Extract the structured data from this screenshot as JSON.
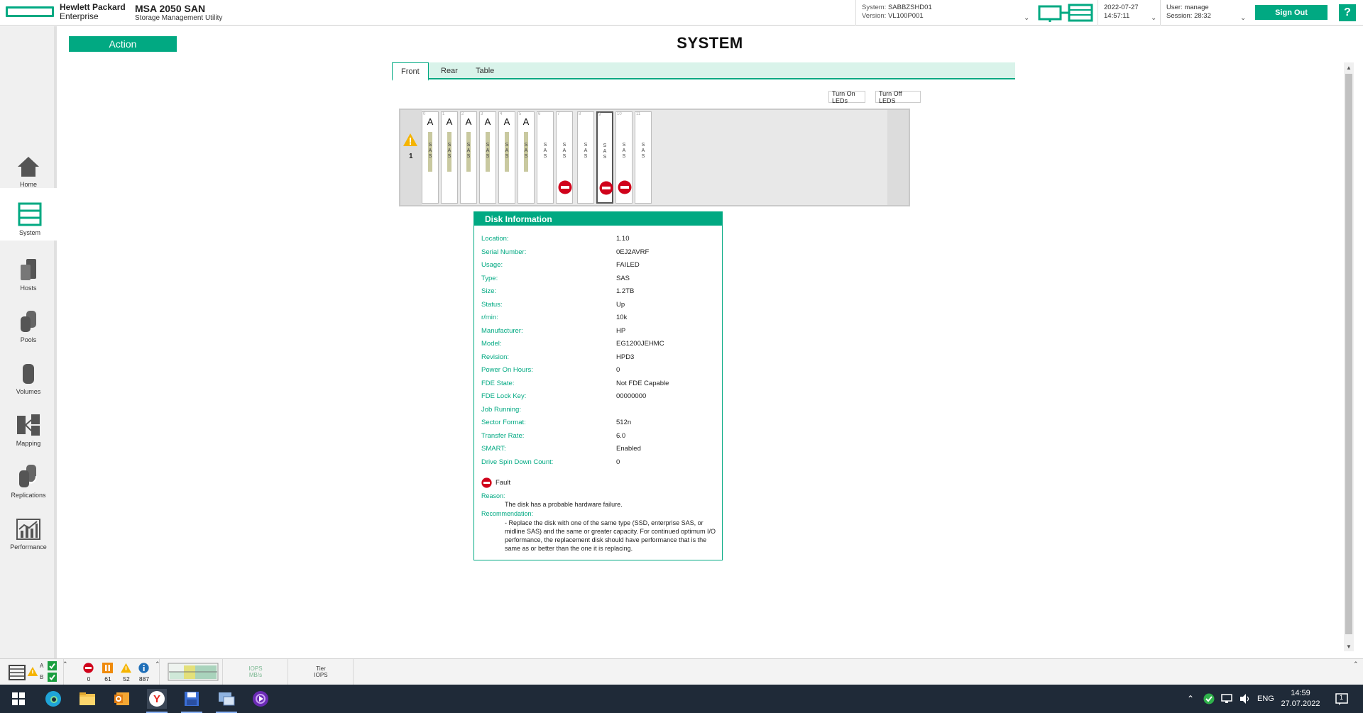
{
  "header": {
    "brand_line1": "Hewlett Packard",
    "brand_line2": "Enterprise",
    "product_name": "MSA 2050 SAN",
    "product_sub": "Storage Management Utility",
    "system_label": "System:",
    "system_value": "SABBZSHD01",
    "version_label": "Version:",
    "version_value": "VL100P001",
    "date": "2022-07-27",
    "time": "14:57:11",
    "user_label": "User:",
    "user_value": "manage",
    "session_label": "Session:",
    "session_value": "28:32",
    "sign_out": "Sign Out",
    "help": "?",
    "accent": "#01a982"
  },
  "nav": {
    "items": [
      {
        "label": "Home",
        "icon": "home-icon"
      },
      {
        "label": "System",
        "icon": "system-icon",
        "active": true
      },
      {
        "label": "Hosts",
        "icon": "hosts-icon"
      },
      {
        "label": "Pools",
        "icon": "pools-icon"
      },
      {
        "label": "Volumes",
        "icon": "volumes-icon"
      },
      {
        "label": "Mapping",
        "icon": "mapping-icon"
      },
      {
        "label": "Replications",
        "icon": "replications-icon"
      },
      {
        "label": "Performance",
        "icon": "performance-icon"
      }
    ]
  },
  "main": {
    "action_label": "Action",
    "title": "SYSTEM",
    "tabs": [
      {
        "label": "Front",
        "active": true
      },
      {
        "label": "Rear"
      },
      {
        "label": "Table"
      }
    ],
    "turn_on_leds": "Turn On LEDs",
    "turn_off_leds": "Turn Off LEDS",
    "enclosure_number": "1",
    "slots": [
      {
        "pool": "A",
        "type": "SAS",
        "fault": false
      },
      {
        "pool": "A",
        "type": "SAS",
        "fault": false
      },
      {
        "pool": "A",
        "type": "SAS",
        "fault": false
      },
      {
        "pool": "A",
        "type": "SAS",
        "fault": false
      },
      {
        "pool": "A",
        "type": "SAS",
        "fault": false
      },
      {
        "pool": "A",
        "type": "SAS",
        "fault": false
      },
      {
        "pool": "",
        "type": "SAS",
        "fault": false
      },
      {
        "pool": "",
        "type": "SAS",
        "fault": true
      },
      {
        "pool": "",
        "type": "SAS",
        "fault": false
      },
      {
        "pool": "",
        "type": "SAS",
        "fault": true,
        "selected": true
      },
      {
        "pool": "",
        "type": "SAS",
        "fault": true
      },
      {
        "pool": "",
        "type": "SAS",
        "fault": false
      }
    ]
  },
  "disk_info": {
    "title": "Disk Information",
    "rows": [
      {
        "k": "Location:",
        "v": "1.10"
      },
      {
        "k": "Serial Number:",
        "v": "0EJ2AVRF"
      },
      {
        "k": "Usage:",
        "v": "FAILED"
      },
      {
        "k": "Type:",
        "v": "SAS"
      },
      {
        "k": "Size:",
        "v": "1.2TB"
      },
      {
        "k": "Status:",
        "v": "Up"
      },
      {
        "k": "r/min:",
        "v": "10k"
      },
      {
        "k": "Manufacturer:",
        "v": "HP"
      },
      {
        "k": "Model:",
        "v": "EG1200JEHMC"
      },
      {
        "k": "Revision:",
        "v": "HPD3"
      },
      {
        "k": "Power On Hours:",
        "v": "0"
      },
      {
        "k": "FDE State:",
        "v": "Not FDE Capable"
      },
      {
        "k": "FDE Lock Key:",
        "v": "00000000"
      },
      {
        "k": "Job Running:",
        "v": ""
      },
      {
        "k": "Sector Format:",
        "v": "512n"
      },
      {
        "k": "Transfer Rate:",
        "v": "6.0"
      },
      {
        "k": "SMART:",
        "v": "Enabled"
      },
      {
        "k": "Drive Spin Down Count:",
        "v": "0"
      }
    ],
    "fault_label": "Fault",
    "reason_label": "Reason:",
    "reason_text": "The disk has a probable hardware failure.",
    "recommendation_label": "Recommendation:",
    "recommendation_text": "- Replace the disk with one of the same type (SSD, enterprise SAS, or midline SAS) and the same or greater capacity. For continued optimum I/O performance, the replacement disk should have performance that is the same as or better than the one it is replacing."
  },
  "statusbar": {
    "ctrl_a": "A",
    "ctrl_b": "B",
    "critical_count": "0",
    "error_count": "61",
    "warning_count": "52",
    "info_count": "887",
    "iops_label": "IOPS",
    "mbs_label": "MB/s",
    "tier_label": "Tier",
    "tier_iops_label": "IOPS"
  },
  "taskbar": {
    "lang": "ENG",
    "time": "14:59",
    "date": "27.07.2022",
    "notif_count": "1"
  }
}
